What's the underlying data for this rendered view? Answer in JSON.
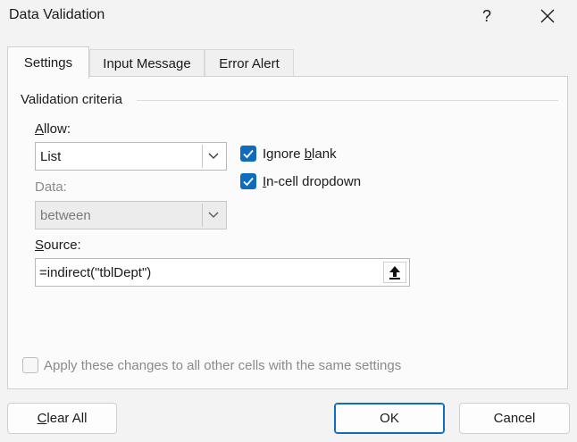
{
  "window": {
    "title": "Data Validation",
    "help_label": "?"
  },
  "tabs": [
    {
      "label": "Settings",
      "active": true
    },
    {
      "label": "Input Message",
      "active": false
    },
    {
      "label": "Error Alert",
      "active": false
    }
  ],
  "settings": {
    "group_label": "Validation criteria",
    "allow": {
      "label_prefix": "",
      "label_access": "A",
      "label_rest": "llow:",
      "value": "List"
    },
    "data": {
      "label": "Data:",
      "value": "between"
    },
    "ignore_blank": {
      "label_before": "Ignore ",
      "label_access": "b",
      "label_after": "lank",
      "checked": true
    },
    "in_cell_dropdown": {
      "label_access": "I",
      "label_after": "n-cell dropdown",
      "checked": true
    },
    "source": {
      "label_access": "S",
      "label_rest": "ource:",
      "value": "=indirect(\"tblDept\")"
    },
    "apply_all": {
      "label": "Apply these changes to all other cells with the same settings",
      "checked": false
    }
  },
  "buttons": {
    "clear_all_access": "C",
    "clear_all_rest": "lear All",
    "ok": "OK",
    "cancel": "Cancel"
  },
  "colors": {
    "accent": "#0f6cbd",
    "dialog_bg": "#f3f3f3",
    "panel_bg": "#fbfbfb"
  }
}
